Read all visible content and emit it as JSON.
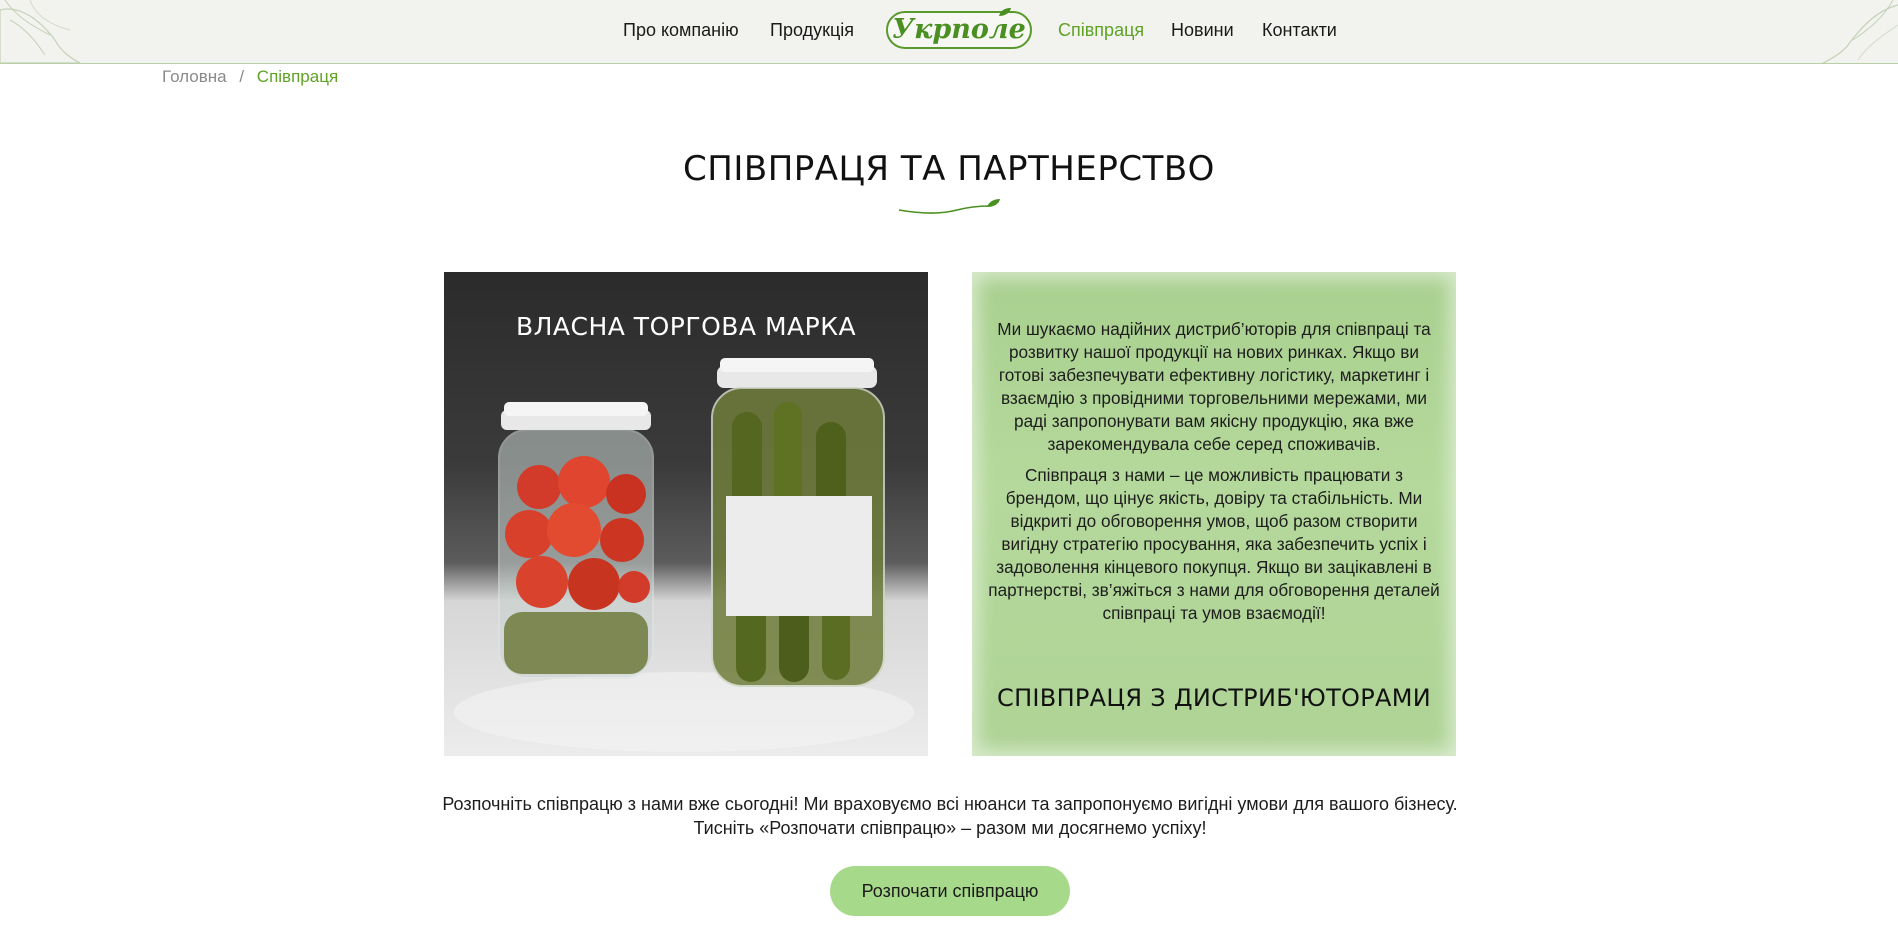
{
  "header": {
    "logo_text": "Укрполе",
    "nav_left": [
      "Про компанію",
      "Продукція"
    ],
    "nav_right": [
      "Співпраця",
      "Новини",
      "Контакти"
    ],
    "active_item": "Співпраця",
    "accent_color": "#5fa226"
  },
  "breadcrumb": {
    "home": "Головна",
    "separator": "/",
    "current": "Співпраця"
  },
  "main": {
    "title": "СПІВПРАЦЯ ТА ПАРТНЕРСТВО",
    "left_card": {
      "title": "ВЛАСНА ТОРГОВА МАРКА"
    },
    "right_card": {
      "paragraph1": "Ми шукаємо надійних дистриб’юторів для співпраці та розвитку нашої продукції на нових ринках. Якщо ви готові забезпечувати ефективну логістику, маркетинг і взаємдію з провідними торговельними мережами, ми раді запропонувати вам якісну продукцію, яка вже зарекомендувала себе серед споживачів.",
      "paragraph2": "Співпраця з нами – це можливість працювати з брендом, що цінує якість, довіру та стабільність. Ми відкриті до обговорення умов, щоб разом створити вигідну стратегію просування, яка забезпечить успіх і задоволення кінцевого покупця. Якщо ви зацікавлені в партнерстві, зв’яжіться з нами для обговорення деталей співпраці та умов взаємодії!",
      "heading": "СПІВПРАЦЯ З ДИСТРИБ'ЮТОРАМИ"
    },
    "cta_text": "Розпочніть співпрацю з нами вже сьогодні! Ми враховуємо всі нюанси та запропонуємо вигідні умови для вашого бізнесу. Тисніть «Розпочати співпрацю» – разом ми досягнемо успіху!",
    "cta_button": "Розпочати співпрацю",
    "button_color": "#a7d98a"
  }
}
